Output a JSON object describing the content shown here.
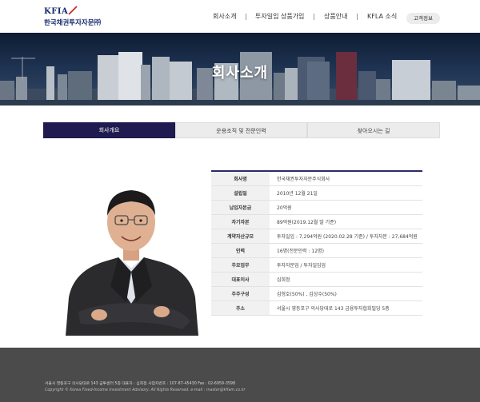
{
  "header": {
    "logo_en": "KFIA",
    "logo_ko": "한국채권투자자문㈜",
    "nav": [
      "회사소개",
      "투자일임 상품가입",
      "상품안내",
      "KFLA 소식"
    ],
    "customer_button": "고객정보"
  },
  "banner": {
    "title": "회사소개"
  },
  "tabs": [
    {
      "label": "회사개요",
      "active": true
    },
    {
      "label": "운용조직 및 전문인력",
      "active": false
    },
    {
      "label": "찾아오시는 길",
      "active": false
    }
  ],
  "info": {
    "rows": [
      {
        "key": "회사명",
        "value": "한국채권투자자문주식회사"
      },
      {
        "key": "설립일",
        "value": "2010년 12월 21일"
      },
      {
        "key": "납입자본금",
        "value": "20억원"
      },
      {
        "key": "자기자본",
        "value": "89억원(2019.12월 말 기준)"
      },
      {
        "key": "계약자산규모",
        "value": "투자일임 : 7,294억원 (2020.02.28 기준) / 투자자문 : 27,684억원"
      },
      {
        "key": "인력",
        "value": "16명(전문인력 : 12명)"
      },
      {
        "key": "주요업무",
        "value": "투자자문업 / 투자일임업"
      },
      {
        "key": "대표이사",
        "value": "심희정"
      },
      {
        "key": "주주구성",
        "value": "김형호(50%) , 김상수(50%)"
      },
      {
        "key": "주소",
        "value": "서울시 영등포구 의사당대로 143 금융투자협회빌딩 5층"
      }
    ]
  },
  "footer": {
    "line1": "서울시 영등포구 의사당대로 143 금투센터 5층 대표자 : 심희정 사업자번호 : 107-87-45430 Fax : 02-6959-3598",
    "line2": "Copyright © Korea Fixed-Income Investment Advisory. All Rights Reserved. e-mail : master@kfiam.co.kr"
  },
  "colors": {
    "brand_navy": "#1a2a6c",
    "tab_active": "#1f1a4f",
    "footer_bg": "#4b4b4b"
  }
}
